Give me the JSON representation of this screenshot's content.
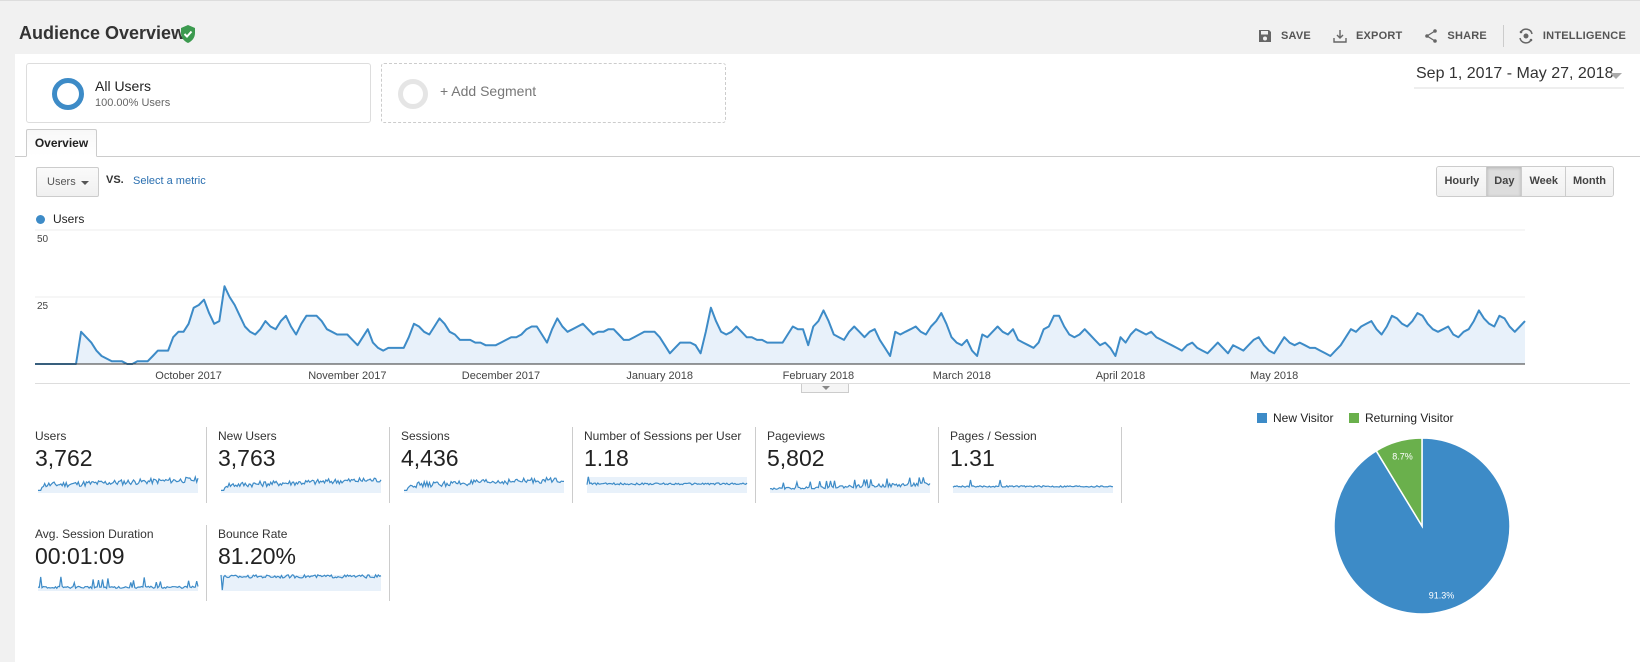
{
  "header": {
    "title": "Audience Overview",
    "toolbar": [
      {
        "icon": "save-icon",
        "label": "SAVE"
      },
      {
        "icon": "export-icon",
        "label": "EXPORT"
      },
      {
        "icon": "share-icon",
        "label": "SHARE"
      },
      {
        "icon": "intelligence-icon",
        "label": "INTELLIGENCE"
      }
    ]
  },
  "segments": {
    "active": {
      "name": "All Users",
      "sub": "100.00% Users"
    },
    "add_label": "+ Add Segment"
  },
  "date_range": "Sep 1, 2017 - May 27, 2018",
  "tabs": [
    {
      "label": "Overview",
      "active": true
    }
  ],
  "metric_selector": {
    "selected": "Users",
    "vs": "VS.",
    "select_metric": "Select a metric"
  },
  "granularity": {
    "options": [
      "Hourly",
      "Day",
      "Week",
      "Month"
    ],
    "active": "Day"
  },
  "chart_data": {
    "type": "line",
    "title": "",
    "series_name": "Users",
    "color": "#3d8bc7",
    "fill": "#e8f1fa",
    "ylim": [
      0,
      50
    ],
    "yticks": [
      "50",
      "25"
    ],
    "xticks": [
      "October 2017",
      "November 2017",
      "December 2017",
      "January 2018",
      "February 2018",
      "March 2018",
      "April 2018",
      "May 2018"
    ],
    "x_start": "2017-09-01",
    "x_end": "2018-05-27",
    "values": [
      0,
      0,
      0,
      0,
      0,
      0,
      0,
      0,
      0,
      12,
      10,
      8,
      5,
      3,
      2,
      1,
      1,
      1,
      0,
      0,
      1,
      1,
      1,
      3,
      5,
      5,
      5,
      10,
      12,
      12,
      15,
      21,
      22,
      24,
      19,
      15,
      16,
      29,
      25,
      22,
      18,
      14,
      12,
      11,
      13,
      16,
      14,
      13,
      16,
      18,
      14,
      11,
      15,
      18,
      18,
      18,
      16,
      13,
      12,
      11,
      11,
      11,
      9,
      7,
      10,
      13,
      8,
      6,
      5,
      6,
      6,
      6,
      6,
      10,
      15,
      14,
      12,
      11,
      14,
      17,
      15,
      12,
      11,
      9,
      9,
      9,
      8,
      8,
      7,
      7,
      7,
      8,
      9,
      10,
      10,
      11,
      13,
      14,
      14,
      11,
      8,
      13,
      17,
      14,
      12,
      13,
      14,
      15,
      13,
      11,
      12,
      12,
      13,
      13,
      11,
      9,
      9,
      10,
      11,
      12,
      12,
      12,
      10,
      7,
      4,
      6,
      8,
      8,
      8,
      7,
      4,
      12,
      21,
      16,
      12,
      11,
      12,
      14,
      12,
      10,
      10,
      9,
      9,
      8,
      8,
      8,
      8,
      11,
      14,
      13,
      13,
      7,
      14,
      16,
      20,
      16,
      11,
      10,
      9,
      12,
      14,
      12,
      10,
      12,
      13,
      9,
      6,
      3,
      12,
      11,
      12,
      13,
      14,
      12,
      11,
      14,
      16,
      19,
      15,
      10,
      8,
      7,
      9,
      5,
      3,
      11,
      10,
      12,
      14,
      12,
      11,
      13,
      9,
      8,
      7,
      6,
      8,
      13,
      14,
      18,
      18,
      14,
      11,
      10,
      11,
      13,
      11,
      9,
      7,
      8,
      6,
      3,
      10,
      8,
      11,
      13,
      12,
      11,
      12,
      10,
      9,
      8,
      7,
      6,
      5,
      7,
      8,
      6,
      5,
      4,
      6,
      8,
      6,
      4,
      7,
      6,
      5,
      7,
      9,
      10,
      7,
      5,
      4,
      7,
      10,
      8,
      7,
      8,
      7,
      6,
      6,
      5,
      4,
      3,
      5,
      7,
      10,
      13,
      12,
      14,
      15,
      16,
      13,
      11,
      14,
      18,
      17,
      15,
      14,
      16,
      19,
      18,
      15,
      13,
      12,
      13,
      14,
      11,
      10,
      12,
      13,
      16,
      20,
      17,
      15,
      14,
      18,
      17,
      14,
      12,
      14,
      16
    ],
    "start_offset_note": "daily values Sep 1 2017 onward"
  },
  "scorecards": [
    {
      "label": "Users",
      "value": "3,762",
      "spark": "rising"
    },
    {
      "label": "New Users",
      "value": "3,763",
      "spark": "rising"
    },
    {
      "label": "Sessions",
      "value": "4,436",
      "spark": "rising"
    },
    {
      "label": "Number of Sessions per User",
      "value": "1.18",
      "spark": "flat-spike-start"
    },
    {
      "label": "Pageviews",
      "value": "5,802",
      "spark": "rising-late"
    },
    {
      "label": "Pages / Session",
      "value": "1.31",
      "spark": "flat"
    },
    {
      "label": "Avg. Session Duration",
      "value": "00:01:09",
      "spark": "spiky"
    },
    {
      "label": "Bounce Rate",
      "value": "81.20%",
      "spark": "high-flat"
    }
  ],
  "pie": {
    "type": "pie",
    "legend": [
      {
        "label": "New Visitor",
        "color": "#3d8bc7"
      },
      {
        "label": "Returning Visitor",
        "color": "#6ab04c"
      }
    ],
    "slices": [
      {
        "label": "New Visitor",
        "value": 91.3,
        "text": "91.3%",
        "color": "#3d8bc7"
      },
      {
        "label": "Returning Visitor",
        "value": 8.7,
        "text": "8.7%",
        "color": "#6ab04c"
      }
    ]
  }
}
